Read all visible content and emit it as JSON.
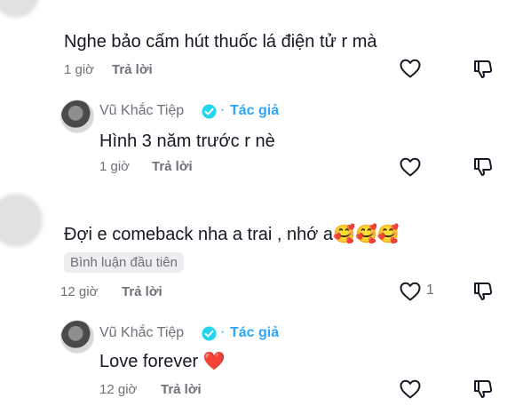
{
  "comments": [
    {
      "text": "Nghe bảo cấm hút thuốc lá điện tử r mà",
      "time": "1 giờ",
      "reply_label": "Trả lời",
      "reply": {
        "author": "Vũ Khắc Tiệp",
        "dot": "·",
        "tag": "Tác giả",
        "text": "Hình 3 năm trước r nè",
        "time": "1 giờ",
        "reply_label": "Trả lời"
      }
    },
    {
      "text": "Đợi e comeback nha a trai , nhớ a🥰🥰🥰",
      "badge": "Bình luận đầu tiên",
      "time": "12 giờ",
      "reply_label": "Trả lời",
      "like_count": "1",
      "reply": {
        "author": "Vũ Khắc Tiệp",
        "dot": "·",
        "tag": "Tác giả",
        "text": "Love forever ❤️",
        "time": "12 giờ",
        "reply_label": "Trả lời"
      }
    }
  ],
  "colors": {
    "text": "#161823",
    "muted": "#6f7078",
    "author_tag": "#2ca5ff",
    "verified": "#20d5ec",
    "badge_bg": "#eeeef0"
  },
  "icons": [
    "heart-icon",
    "dislike-icon",
    "verified-badge-icon"
  ]
}
